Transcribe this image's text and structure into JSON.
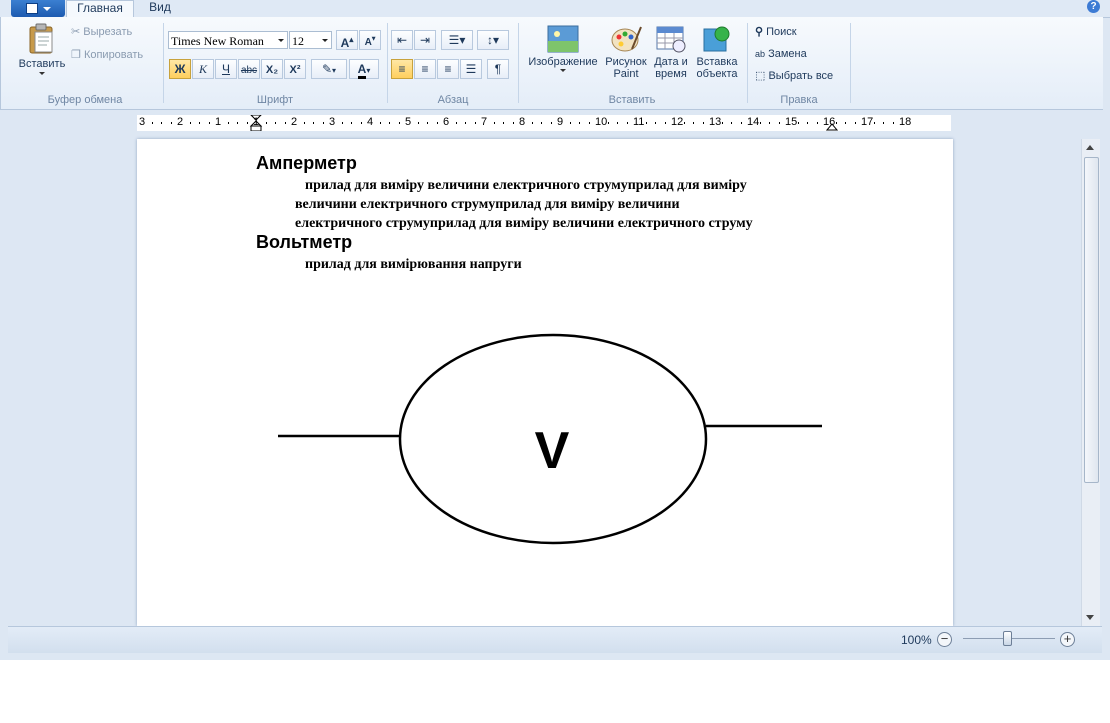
{
  "tabs": [
    {
      "label": "Главная",
      "active": true
    },
    {
      "label": "Вид",
      "active": false
    }
  ],
  "ribbon": {
    "clipboard": {
      "paste_label": "Вставить",
      "cut_label": "Вырезать",
      "copy_label": "Копировать",
      "group_label": "Буфер обмена"
    },
    "font": {
      "family": "Times New Roman",
      "size": "12",
      "bold_label": "Ж",
      "italic_label": "К",
      "underline_label": "Ч",
      "strike_label": "abc",
      "sub_label": "X₂",
      "sup_label": "X²",
      "group_label": "Шрифт"
    },
    "paragraph": {
      "group_label": "Абзац"
    },
    "insert": {
      "image_label": "Изображение",
      "paint_label_1": "Рисунок",
      "paint_label_2": "Paint",
      "datetime_label_1": "Дата и",
      "datetime_label_2": "время",
      "object_label_1": "Вставка",
      "object_label_2": "объекта",
      "group_label": "Вставить"
    },
    "edit": {
      "find_label": "Поиск",
      "replace_label": "Замена",
      "select_all_label": "Выбрать все",
      "group_label": "Правка"
    }
  },
  "ruler": {
    "labels": [
      "3",
      "2",
      "1",
      "1",
      "2",
      "3",
      "4",
      "5",
      "6",
      "7",
      "8",
      "9",
      "10",
      "11",
      "12",
      "13",
      "14",
      "15",
      "16",
      "17",
      "18"
    ]
  },
  "document": {
    "heading1": "Амперметр",
    "para1_line1": "прилад для виміру величини електричного струмуприлад для виміру",
    "para1_line2": "величини електричного струмуприлад для виміру величини",
    "para1_line3": "електричного струмуприлад для виміру величини електричного струму",
    "heading2": "Вольтметр",
    "para2": "прилад для вимірювання напруги",
    "symbol_letter": "V"
  },
  "status": {
    "zoom": "100%"
  },
  "colors": {
    "accent": "#1d5bb0",
    "ribbon_bg": "#e4edf8",
    "frame": "#dde7f3"
  }
}
